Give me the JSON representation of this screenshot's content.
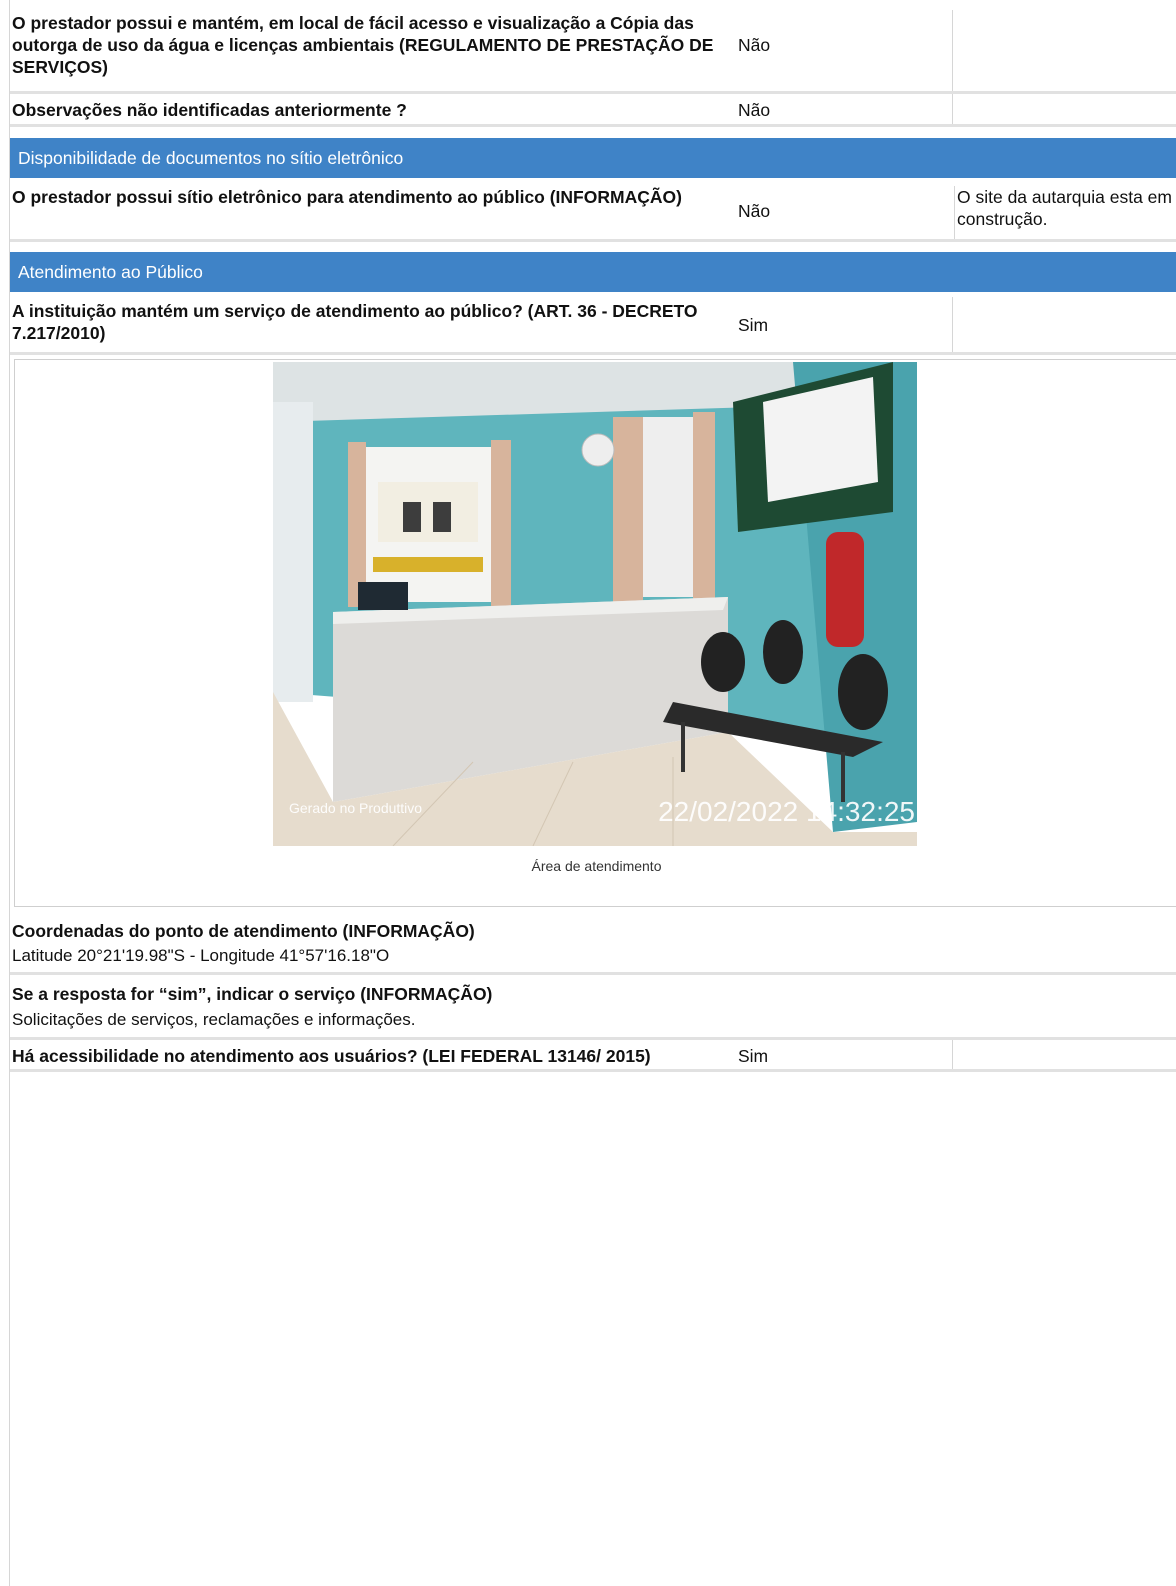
{
  "rows": {
    "r1": {
      "question": "O prestador possui e mantém, em local de fácil acesso e visualização a Cópia das outorga de uso da água e licenças ambientais (REGULAMENTO DE PRESTAÇÃO DE SERVIÇOS)",
      "answer": "Não",
      "note": ""
    },
    "r2": {
      "question": "Observações não identificadas anteriormente ?",
      "answer": "Não",
      "note": ""
    },
    "r3": {
      "question": "O prestador possui sítio eletrônico para atendimento ao público (INFORMAÇÃO)",
      "answer": "Não",
      "note": "O site da autarquia esta em construção."
    },
    "r4": {
      "question": "A instituição mantém um serviço de atendimento ao público? (ART. 36 - DECRETO 7.217/2010)",
      "answer": "Sim",
      "note": ""
    },
    "r5": {
      "question": "Há acessibilidade no atendimento aos usuários? (LEI FEDERAL 13146/ 2015)",
      "answer": "Sim",
      "note": ""
    }
  },
  "sections": {
    "documentos": "Disponibilidade de documentos no sítio eletrônico",
    "atendimento": "Atendimento ao Público"
  },
  "photo": {
    "watermark_app": "Gerado no Produttivo",
    "watermark_timestamp": "22/02/2022 14:32:25",
    "caption": "Área de atendimento"
  },
  "coordinates": {
    "title": "Coordenadas do ponto de atendimento (INFORMAÇÃO)",
    "value": "Latitude 20°21'19.98\"S - Longitude 41°57'16.18\"O"
  },
  "service": {
    "title": "Se a resposta for “sim”, indicar o serviço (INFORMAÇÃO)",
    "value": "Solicitações de serviços, reclamações e informações."
  }
}
